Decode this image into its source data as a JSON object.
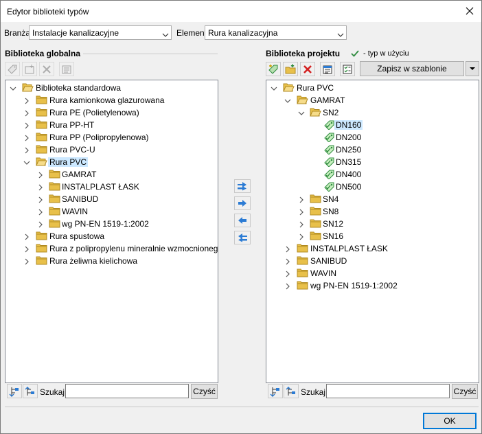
{
  "window": {
    "title": "Edytor biblioteki typów"
  },
  "filters": {
    "branza_label": "Branża",
    "branza_value": "Instalacje kanalizacyjne",
    "element_label": "Element",
    "element_value": "Rura kanalizacyjna"
  },
  "global": {
    "title": "Biblioteka globalna",
    "search_label": "Szukaj:",
    "search_value": "",
    "clear_label": "Czyść",
    "tree": [
      "Biblioteka standardowa",
      "Rura kamionkowa glazurowana",
      "Rura PE (Polietylenowa)",
      "Rura PP-HT",
      "Rura PP (Polipropylenowa)",
      "Rura PVC-U",
      "Rura PVC",
      "GAMRAT",
      "INSTALPLAST ŁASK",
      "SANIBUD",
      "WAVIN",
      "wg PN-EN 1519-1:2002",
      "Rura spustowa",
      "Rura z polipropylenu mineralnie wzmocnionego",
      "Rura żeliwna kielichowa"
    ]
  },
  "project": {
    "title": "Biblioteka projektu",
    "legend": "- typ w użyciu",
    "save_template": "Zapisz w szablonie",
    "search_label": "Szukaj:",
    "search_value": "",
    "clear_label": "Czyść",
    "tree": [
      "Rura PVC",
      "GAMRAT",
      "SN2",
      "DN160",
      "DN200",
      "DN250",
      "DN315",
      "DN400",
      "DN500",
      "SN4",
      "SN8",
      "SN12",
      "SN16",
      "INSTALPLAST ŁASK",
      "SANIBUD",
      "WAVIN",
      "wg PN-EN 1519-1:2002"
    ]
  },
  "footer": {
    "ok_label": "OK"
  },
  "colors": {
    "accent": "#0078d7",
    "folder": "#e8c04a",
    "tag_green": "#2e8b3e",
    "selection": "#cce8ff",
    "delete_red": "#d32020",
    "arrow_blue": "#2b7bd4"
  },
  "icons": [
    "close-icon",
    "chevron-down-icon",
    "folder-icon",
    "folder-open-icon",
    "tag-icon",
    "check-icon",
    "arrow-right-icon",
    "arrow-left-icon",
    "double-arrow-right-icon",
    "double-arrow-left-icon",
    "expand-all-icon",
    "collapse-all-icon",
    "new-tag-icon",
    "new-folder-icon",
    "delete-icon",
    "properties-icon",
    "sort-icon"
  ]
}
